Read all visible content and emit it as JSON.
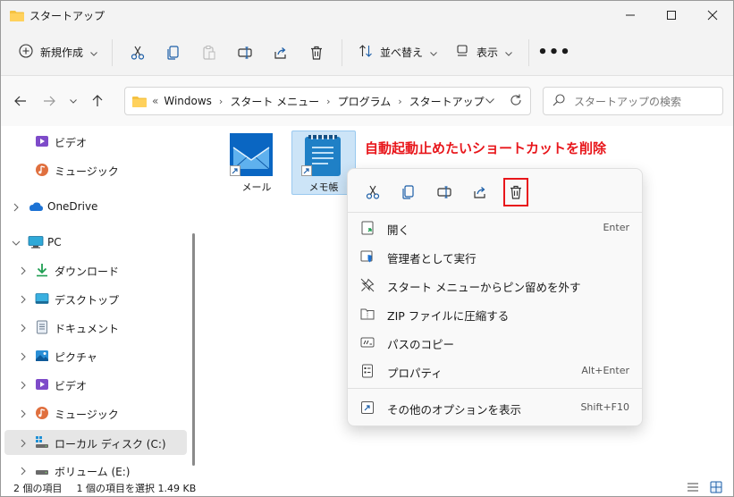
{
  "window": {
    "title": "スタートアップ"
  },
  "toolbar": {
    "new_label": "新規作成",
    "sort_label": "並べ替え",
    "view_label": "表示",
    "more_label": "•••"
  },
  "address": {
    "overflow": "«",
    "crumbs": [
      "Windows",
      "スタート メニュー",
      "プログラム",
      "スタートアップ"
    ]
  },
  "search": {
    "placeholder": "スタートアップの検索"
  },
  "sidebar": {
    "items": [
      {
        "label": "ビデオ"
      },
      {
        "label": "ミュージック"
      },
      {
        "label": "OneDrive"
      },
      {
        "label": "PC"
      },
      {
        "label": "ダウンロード"
      },
      {
        "label": "デスクトップ"
      },
      {
        "label": "ドキュメント"
      },
      {
        "label": "ピクチャ"
      },
      {
        "label": "ビデオ"
      },
      {
        "label": "ミュージック"
      },
      {
        "label": "ローカル ディスク (C:)"
      },
      {
        "label": "ボリューム (E:)"
      }
    ]
  },
  "files": [
    {
      "name": "メール"
    },
    {
      "name": "メモ帳"
    }
  ],
  "annotation": "自動起動止めたいショートカットを削除",
  "context_menu": {
    "items": [
      {
        "label": "開く",
        "shortcut": "Enter"
      },
      {
        "label": "管理者として実行",
        "shortcut": ""
      },
      {
        "label": "スタート メニューからピン留めを外す",
        "shortcut": ""
      },
      {
        "label": "ZIP ファイルに圧縮する",
        "shortcut": ""
      },
      {
        "label": "パスのコピー",
        "shortcut": ""
      },
      {
        "label": "プロパティ",
        "shortcut": "Alt+Enter"
      },
      {
        "label": "その他のオプションを表示",
        "shortcut": "Shift+F10"
      }
    ]
  },
  "status": {
    "item_count": "2 個の項目",
    "selection": "1 個の項目を選択  1.49 KB"
  },
  "colors": {
    "accent": "#0067c0",
    "highlight": "#e8161b",
    "selection": "#cce4f7"
  }
}
